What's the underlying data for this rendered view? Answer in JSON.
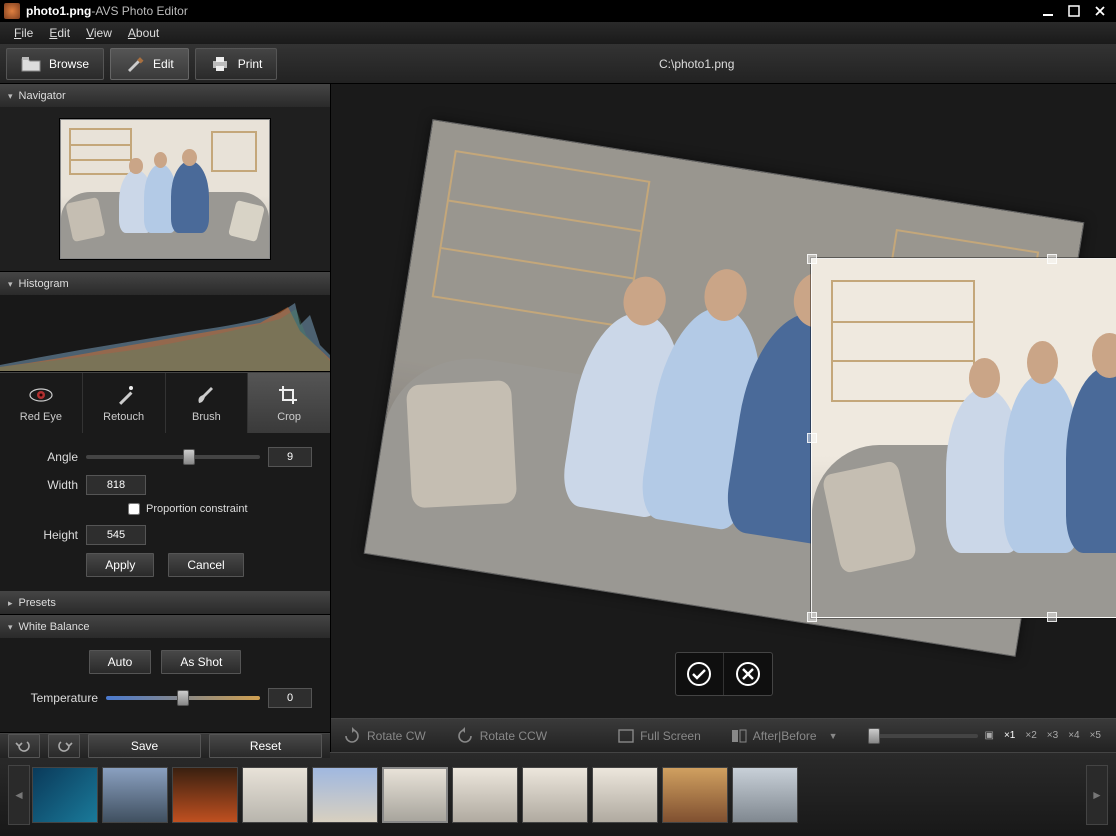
{
  "title": {
    "filename": "photo1.png",
    "separator": "  -  ",
    "app": "AVS Photo Editor"
  },
  "menu": {
    "file": "File",
    "edit": "Edit",
    "view": "View",
    "about": "About"
  },
  "toolbar": {
    "browse": "Browse",
    "edit": "Edit",
    "print": "Print"
  },
  "path": "C:\\photo1.png",
  "panels": {
    "navigator": "Navigator",
    "histogram": "Histogram",
    "presets": "Presets",
    "white_balance": "White Balance"
  },
  "tools": {
    "red_eye": "Red Eye",
    "retouch": "Retouch",
    "brush": "Brush",
    "crop": "Crop"
  },
  "crop": {
    "angle_label": "Angle",
    "angle_value": "9",
    "width_label": "Width",
    "width_value": "818",
    "height_label": "Height",
    "height_value": "545",
    "proportion": "Proportion constraint",
    "apply": "Apply",
    "cancel": "Cancel"
  },
  "wb": {
    "auto": "Auto",
    "as_shot": "As Shot",
    "temperature": "Temperature",
    "temp_value": "0"
  },
  "left_actions": {
    "save": "Save",
    "reset": "Reset"
  },
  "view": {
    "rotate_cw": "Rotate CW",
    "rotate_ccw": "Rotate CCW",
    "full_screen": "Full Screen",
    "after_before": "After|Before",
    "zoom_levels": [
      "×1",
      "×2",
      "×3",
      "×4",
      "×5"
    ]
  }
}
